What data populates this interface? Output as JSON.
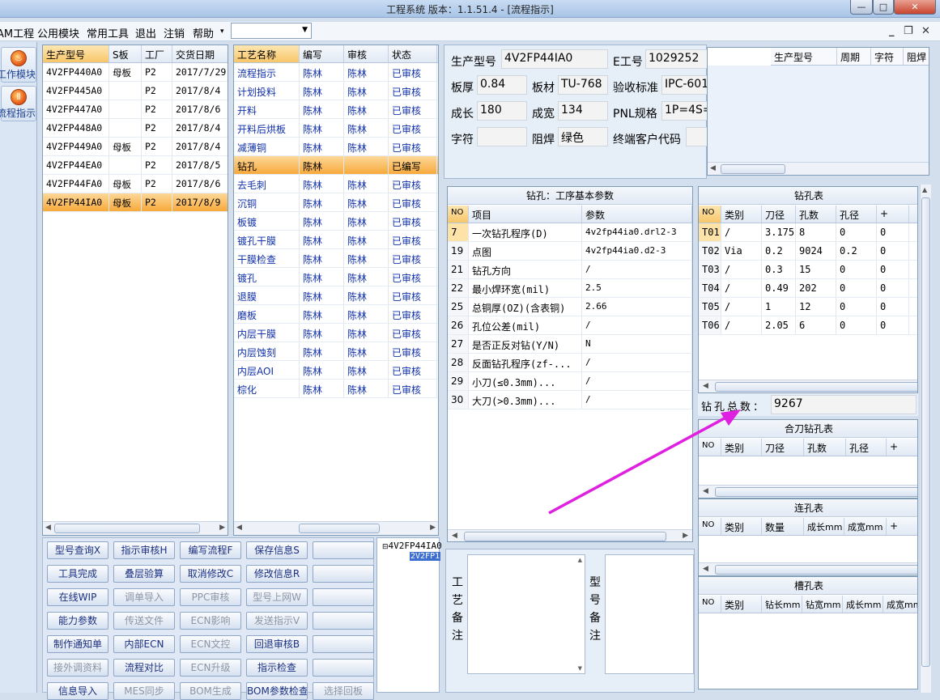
{
  "window": {
    "title": "工程系统   版本：1.1.51.4 - [流程指示]"
  },
  "menu": {
    "items": [
      "AM工程",
      "公用模块",
      "常用工具",
      "退出",
      "注销",
      "帮助"
    ],
    "dropdown_arrow": "▾",
    "combo_value": ""
  },
  "sidebar": {
    "items": [
      {
        "label": "工作模块",
        "icon": "flame-icon"
      },
      {
        "label": "流程指示",
        "icon": "flow-icon"
      }
    ]
  },
  "orders": {
    "columns": [
      "生产型号",
      "S板",
      "工厂",
      "交货日期"
    ],
    "rows": [
      [
        "4V2FP440A0",
        "母板",
        "P2",
        "2017/7/29"
      ],
      [
        "4V2FP445A0",
        "",
        "P2",
        "2017/8/4"
      ],
      [
        "4V2FP447A0",
        "",
        "P2",
        "2017/8/6"
      ],
      [
        "4V2FP448A0",
        "",
        "P2",
        "2017/8/4"
      ],
      [
        "4V2FP449A0",
        "母板",
        "P2",
        "2017/8/4"
      ],
      [
        "4V2FP44EA0",
        "",
        "P2",
        "2017/8/5"
      ],
      [
        "4V2FP44FA0",
        "母板",
        "P2",
        "2017/8/6"
      ],
      [
        "4V2FP44IA0",
        "母板",
        "P2",
        "2017/8/9"
      ]
    ]
  },
  "process": {
    "columns": [
      "工艺名称",
      "编写",
      "审核",
      "状态"
    ],
    "rows": [
      [
        "流程指示",
        "陈林",
        "陈林",
        "已审核"
      ],
      [
        "计划投料",
        "陈林",
        "陈林",
        "已审核"
      ],
      [
        "开料",
        "陈林",
        "陈林",
        "已审核"
      ],
      [
        "开料后烘板",
        "陈林",
        "陈林",
        "已审核"
      ],
      [
        "减薄铜",
        "陈林",
        "陈林",
        "已审核"
      ],
      [
        "钻孔",
        "陈林",
        "",
        "已编写"
      ],
      [
        "去毛刺",
        "陈林",
        "陈林",
        "已审核"
      ],
      [
        "沉铜",
        "陈林",
        "陈林",
        "已审核"
      ],
      [
        "板镀",
        "陈林",
        "陈林",
        "已审核"
      ],
      [
        "镀孔干膜",
        "陈林",
        "陈林",
        "已审核"
      ],
      [
        "干膜检查",
        "陈林",
        "陈林",
        "已审核"
      ],
      [
        "镀孔",
        "陈林",
        "陈林",
        "已审核"
      ],
      [
        "退膜",
        "陈林",
        "陈林",
        "已审核"
      ],
      [
        "磨板",
        "陈林",
        "陈林",
        "已审核"
      ],
      [
        "内层干膜",
        "陈林",
        "陈林",
        "已审核"
      ],
      [
        "内层蚀刻",
        "陈林",
        "陈林",
        "已审核"
      ],
      [
        "内层AOI",
        "陈林",
        "陈林",
        "已审核"
      ],
      [
        "棕化",
        "陈林",
        "陈林",
        "已审核"
      ]
    ]
  },
  "buttons": [
    [
      "型号查询X",
      "指示审核H",
      "编写流程F",
      "保存信息S",
      ""
    ],
    [
      "工具完成",
      "叠层验算",
      "取消修改C",
      "修改信息R",
      ""
    ],
    [
      "在线WIP",
      "调单导入",
      "PPC审核",
      "型号上网W",
      ""
    ],
    [
      "能力参数",
      "传送文件",
      "ECN影响",
      "发送指示V",
      ""
    ],
    [
      "制作通知单",
      "内部ECN",
      "ECN文控",
      "回退审核B",
      ""
    ],
    [
      "接外调资料",
      "流程对比",
      "ECN升级",
      "指示检查",
      ""
    ],
    [
      "信息导入",
      "MES同步",
      "BOM生成",
      "BOM参数检查",
      "选择回板"
    ]
  ],
  "tree": {
    "root": "4V2FP44IA0",
    "child": "2V2FP1"
  },
  "info": {
    "model_label": "生产型号",
    "model": "4V2FP44IA0",
    "eng_label": "E工号",
    "eng": "1029252",
    "thick_label": "板厚",
    "thick": "0.84",
    "material_label": "板材",
    "material": "TU-768",
    "std_label": "验收标准",
    "std": "IPC-601",
    "len_label": "成长",
    "len": "180",
    "wid_label": "成宽",
    "wid": "134",
    "pnl_label": "PNL规格",
    "pnl": "1P=4S=",
    "char_label": "字符",
    "char": "",
    "mask_label": "阻焊",
    "mask": "绿色",
    "cust_label": "终端客户代码",
    "cust": ""
  },
  "mini_grid": {
    "columns": [
      "生产型号",
      "周期",
      "字符",
      "阻焊"
    ]
  },
  "params": {
    "title": "钻孔：工序基本参数",
    "columns": [
      "NO",
      "项目",
      "参数"
    ],
    "rows": [
      [
        "7",
        "一次钻孔程序(D)",
        "4v2fp44ia0.drl2-3"
      ],
      [
        "19",
        "点图",
        "4v2fp44ia0.d2-3"
      ],
      [
        "21",
        "钻孔方向",
        "/"
      ],
      [
        "22",
        "最小焊环宽(mil)",
        "2.5"
      ],
      [
        "25",
        "总铜厚(OZ)(含表铜)",
        "2.66"
      ],
      [
        "26",
        "孔位公差(mil)",
        "/"
      ],
      [
        "27",
        "是否正反对钻(Y/N)",
        "N"
      ],
      [
        "28",
        "反面钻孔程序(zf-...",
        "/"
      ],
      [
        "29",
        "小刀(≤0.3mm)...",
        "/"
      ],
      [
        "30",
        "大刀(>0.3mm)...",
        "/"
      ]
    ]
  },
  "drill": {
    "title": "钻孔表",
    "columns": [
      "NO",
      "类别",
      "刀径",
      "孔数",
      "孔径",
      "+"
    ],
    "rows": [
      [
        "T01",
        "/",
        "3.175",
        "8",
        "0",
        "0"
      ],
      [
        "T02",
        "Via",
        "0.2",
        "9024",
        "0.2",
        "0"
      ],
      [
        "T03",
        "/",
        "0.3",
        "15",
        "0",
        "0"
      ],
      [
        "T04",
        "/",
        "0.49",
        "202",
        "0",
        "0"
      ],
      [
        "T05",
        "/",
        "1",
        "12",
        "0",
        "0"
      ],
      [
        "T06",
        "/",
        "2.05",
        "6",
        "0",
        "0"
      ]
    ],
    "total_label": "钻孔总数：",
    "total": "9267"
  },
  "combo_drill": {
    "title": "合刀钻孔表",
    "columns": [
      "NO",
      "类别",
      "刀径",
      "孔数",
      "孔径",
      "+"
    ]
  },
  "link_holes": {
    "title": "连孔表",
    "columns": [
      "NO",
      "类别",
      "数量",
      "成长mm",
      "成宽mm",
      "+"
    ]
  },
  "slot_holes": {
    "title": "槽孔表",
    "columns": [
      "NO",
      "类别",
      "钻长mm",
      "钻宽mm",
      "成长mm",
      "成宽mm"
    ]
  },
  "notes": {
    "process_label": "工艺备注",
    "model_label": "型号备注"
  },
  "annotation_color": "#e020e0"
}
